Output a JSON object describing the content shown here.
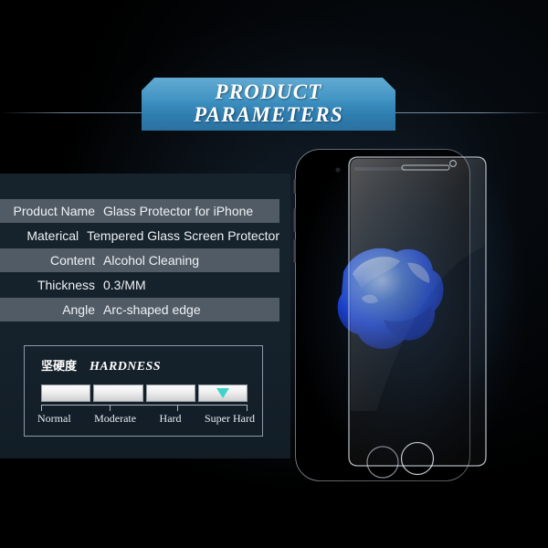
{
  "banner": {
    "line1": "PRODUCT",
    "line2": "PARAMETERS",
    "color": "#3d91c2"
  },
  "parameters": {
    "rows": [
      {
        "key": "Product Name",
        "value": "Glass Protector for iPhone",
        "striped": true
      },
      {
        "key": "Materical",
        "value": "Tempered Glass Screen Protector",
        "striped": false
      },
      {
        "key": "Content",
        "value": "Alcohol Cleaning",
        "striped": true
      },
      {
        "key": "Thickness",
        "value": "0.3/MM",
        "striped": false
      },
      {
        "key": "Angle",
        "value": "Arc-shaped edge",
        "striped": true
      }
    ]
  },
  "hardness": {
    "title_cn": "坚硬度",
    "title_en": "HARDNESS",
    "marker_color": "#3fd3cb",
    "selected_index": 3,
    "levels": [
      "Normal",
      "Moderate",
      "Hard",
      "Super Hard"
    ]
  },
  "artwork": {
    "phone_label": "iphone-device",
    "glass_label": "tempered-glass-sheet",
    "wallpaper_label": "blue-water-drop-wallpaper",
    "wallpaper_color": "#1840e0"
  }
}
